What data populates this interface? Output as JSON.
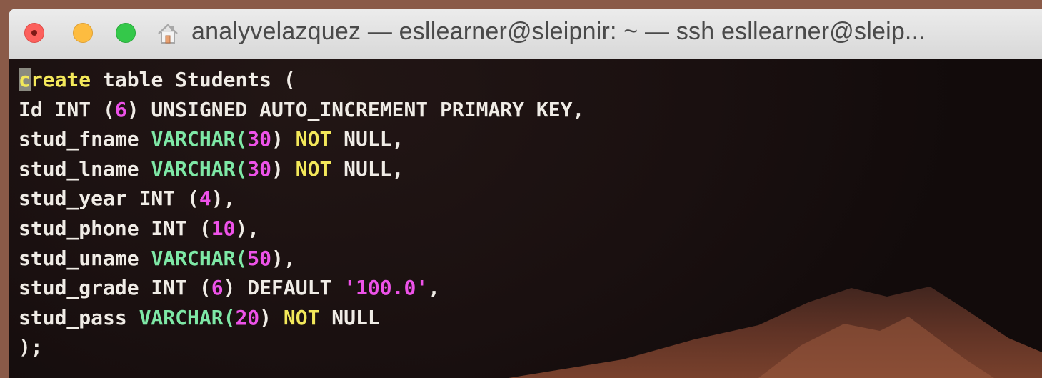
{
  "window": {
    "title": "analyvelazquez — esllearner@sleipnir: ~ — ssh esllearner@sleip...",
    "icons": [
      "close-button",
      "minimize-button",
      "zoom-button",
      "home-icon"
    ]
  },
  "colors": {
    "keyword_type": "#7ee8a6",
    "keyword_null": "#f3e85a",
    "number": "#ee52e9",
    "text": "#f0ece6",
    "background": "#1d1312"
  },
  "terminal": {
    "lines": [
      [
        {
          "t": "c",
          "c": "cursor"
        },
        {
          "t": "reate",
          "c": "kw-create"
        },
        {
          "t": " table Students (",
          "c": ""
        }
      ],
      [
        {
          "t": "Id INT (",
          "c": ""
        },
        {
          "t": "6",
          "c": "num"
        },
        {
          "t": ") UNSIGNED AUTO_INCREMENT PRIMARY KEY,",
          "c": ""
        }
      ],
      [
        {
          "t": "stud_fname ",
          "c": ""
        },
        {
          "t": "VARCHAR(",
          "c": "kw-type"
        },
        {
          "t": "30",
          "c": "num"
        },
        {
          "t": ") ",
          "c": ""
        },
        {
          "t": "NOT",
          "c": "kw-null"
        },
        {
          "t": " NULL,",
          "c": ""
        }
      ],
      [
        {
          "t": "stud_lname ",
          "c": ""
        },
        {
          "t": "VARCHAR(",
          "c": "kw-type"
        },
        {
          "t": "30",
          "c": "num"
        },
        {
          "t": ") ",
          "c": ""
        },
        {
          "t": "NOT",
          "c": "kw-null"
        },
        {
          "t": " NULL,",
          "c": ""
        }
      ],
      [
        {
          "t": "stud_year INT (",
          "c": ""
        },
        {
          "t": "4",
          "c": "num"
        },
        {
          "t": "),",
          "c": ""
        }
      ],
      [
        {
          "t": "stud_phone INT (",
          "c": ""
        },
        {
          "t": "10",
          "c": "num"
        },
        {
          "t": "),",
          "c": ""
        }
      ],
      [
        {
          "t": "stud_uname ",
          "c": ""
        },
        {
          "t": "VARCHAR(",
          "c": "kw-type"
        },
        {
          "t": "50",
          "c": "num"
        },
        {
          "t": "),",
          "c": ""
        }
      ],
      [
        {
          "t": "stud_grade INT (",
          "c": ""
        },
        {
          "t": "6",
          "c": "num"
        },
        {
          "t": ") DEFAULT ",
          "c": ""
        },
        {
          "t": "'100.0'",
          "c": "str"
        },
        {
          "t": ",",
          "c": ""
        }
      ],
      [
        {
          "t": "stud_pass ",
          "c": ""
        },
        {
          "t": "VARCHAR(",
          "c": "kw-type"
        },
        {
          "t": "20",
          "c": "num"
        },
        {
          "t": ") ",
          "c": ""
        },
        {
          "t": "NOT",
          "c": "kw-null"
        },
        {
          "t": " NULL",
          "c": ""
        }
      ],
      [
        {
          "t": ");",
          "c": ""
        }
      ]
    ]
  }
}
